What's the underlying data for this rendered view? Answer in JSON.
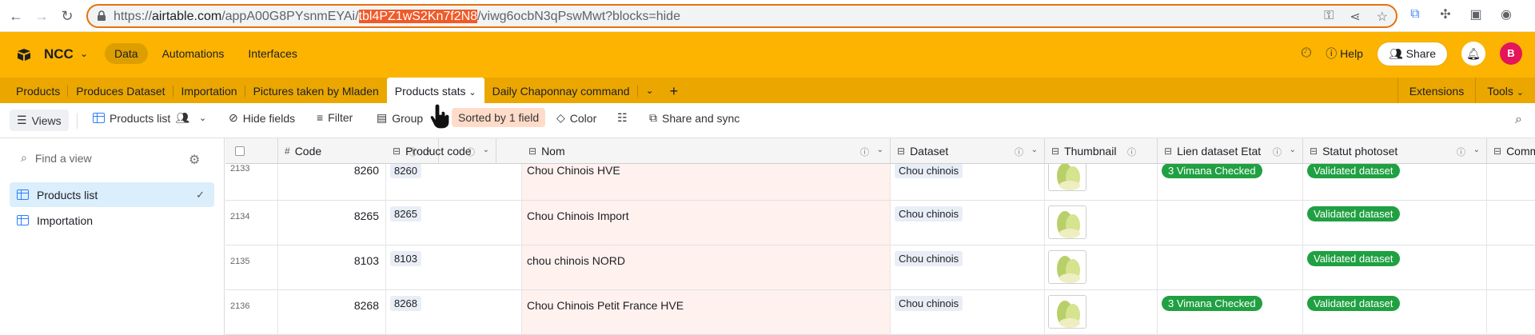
{
  "browser": {
    "url_prefix": "https://",
    "url_domain": "airtable.com",
    "url_path1": "/appA00G8PYsnmEYAi/",
    "url_selected": "tbl4PZ1wS2Kn7f2N8",
    "url_path2": "/viwg6ocbN3qPswMwt?blocks=hide"
  },
  "app": {
    "base_name": "NCC",
    "nav": [
      "Data",
      "Automations",
      "Interfaces"
    ],
    "help": "Help",
    "share": "Share",
    "avatar_initial": "B"
  },
  "tables": {
    "tabs": [
      "Products",
      "Produces Dataset",
      "Importation",
      "Pictures taken by Mladen",
      "Products stats",
      "Daily Chaponnay command"
    ],
    "active_index": 4,
    "extensions": "Extensions",
    "tools": "Tools"
  },
  "viewbar": {
    "views": "Views",
    "current_view": "Products list",
    "hide_fields": "Hide fields",
    "filter": "Filter",
    "group": "Group",
    "sorted": "Sorted by 1 field",
    "color": "Color",
    "share_sync": "Share and sync"
  },
  "sidebar": {
    "find_placeholder": "Find a view",
    "views": [
      {
        "label": "Products list",
        "active": true
      },
      {
        "label": "Importation",
        "active": false
      }
    ]
  },
  "grid": {
    "columns": [
      "Code",
      "Product code",
      "Nom",
      "Dataset",
      "Thumbnail",
      "Lien dataset Etat",
      "Statut photoset",
      "Comme"
    ],
    "rows": [
      {
        "num": "2133",
        "code": "8260",
        "product_code": "8260",
        "nom": "Chou Chinois HVE",
        "dataset": "Chou chinois",
        "lien": "3 Vimana Checked",
        "statut": "Validated dataset"
      },
      {
        "num": "2134",
        "code": "8265",
        "product_code": "8265",
        "nom": "Chou Chinois Import",
        "dataset": "Chou chinois",
        "lien": "",
        "statut": "Validated dataset"
      },
      {
        "num": "2135",
        "code": "8103",
        "product_code": "8103",
        "nom": "chou chinois NORD",
        "dataset": "Chou chinois",
        "lien": "",
        "statut": "Validated dataset"
      },
      {
        "num": "2136",
        "code": "8268",
        "product_code": "8268",
        "nom": "Chou Chinois Petit France HVE",
        "dataset": "Chou chinois",
        "lien": "3 Vimana Checked",
        "statut": "Validated dataset"
      }
    ]
  },
  "colors": {
    "header": "#fcb400",
    "tabs_bar": "#eba700",
    "badge_green": "#20a042",
    "selection": "#dbeefc"
  }
}
